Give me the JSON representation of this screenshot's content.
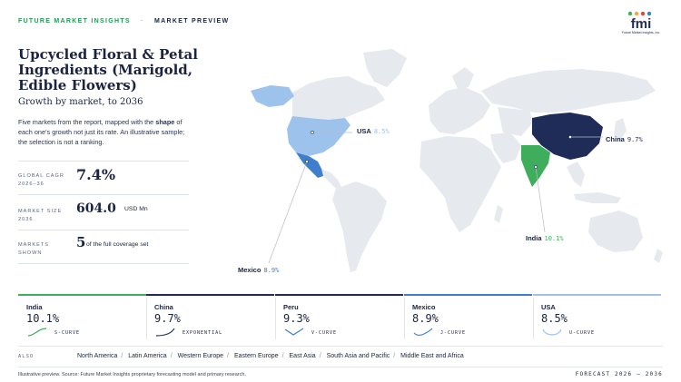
{
  "header": {
    "brand": "FUTURE MARKET INSIGHTS",
    "separator": "·",
    "section": "MARKET PREVIEW"
  },
  "logo": {
    "text": "fmi",
    "caption": "Future Market Insights, Inc."
  },
  "title": "Upcycled Floral & Petal Ingredients (Marigold, Edible Flowers)",
  "subtitle": "Growth by market, to 2036",
  "intro": {
    "before": "Five markets from the report, mapped with the ",
    "bold": "shape",
    "after": " of each one’s growth not just its rate. An illustrative sample; the selection is not a ranking."
  },
  "stats": [
    {
      "label": "GLOBAL CAGR 2026–36",
      "value": "7.4%",
      "unit": ""
    },
    {
      "label": "MARKET SIZE 2036",
      "value": "604.0",
      "unit": "USD Mn"
    },
    {
      "label": "MARKETS SHOWN",
      "value": "5",
      "unit": "of the full coverage set"
    }
  ],
  "map_labels": [
    {
      "name": "USA",
      "pct": "8.5%"
    },
    {
      "name": "China",
      "pct": "9.7%"
    },
    {
      "name": "India",
      "pct": "10.1%"
    },
    {
      "name": "Mexico",
      "pct": "8.9%"
    }
  ],
  "cards": [
    {
      "name": "India",
      "value": "10.1%",
      "shape": "S-CURVE",
      "color": "#3fae5c"
    },
    {
      "name": "China",
      "value": "9.7%",
      "shape": "EXPONENTIAL",
      "color": "#1e2c57"
    },
    {
      "name": "Peru",
      "value": "9.3%",
      "shape": "V-CURVE",
      "color": "#1e2c57"
    },
    {
      "name": "Mexico",
      "value": "8.9%",
      "shape": "J-CURVE",
      "color": "#3d7fcc"
    },
    {
      "name": "USA",
      "value": "8.5%",
      "shape": "U-CURVE",
      "color": "#9dc3ec"
    }
  ],
  "also": {
    "label": "ALSO",
    "regions": [
      "North America",
      "Latin America",
      "Western Europe",
      "Eastern Europe",
      "East Asia",
      "South Asia and Pacific",
      "Middle East and Africa"
    ]
  },
  "footer": {
    "left": "Illustrative preview. Source: Future Market Insights proprietary forecasting model and primary research.",
    "right": "FORECAST 2026 – 2036"
  },
  "colors": {
    "green": "#3fae5c",
    "navy": "#1e2c57",
    "blue": "#3d7fcc",
    "light_blue": "#9dc3ec",
    "land": "#e6e9ee"
  }
}
